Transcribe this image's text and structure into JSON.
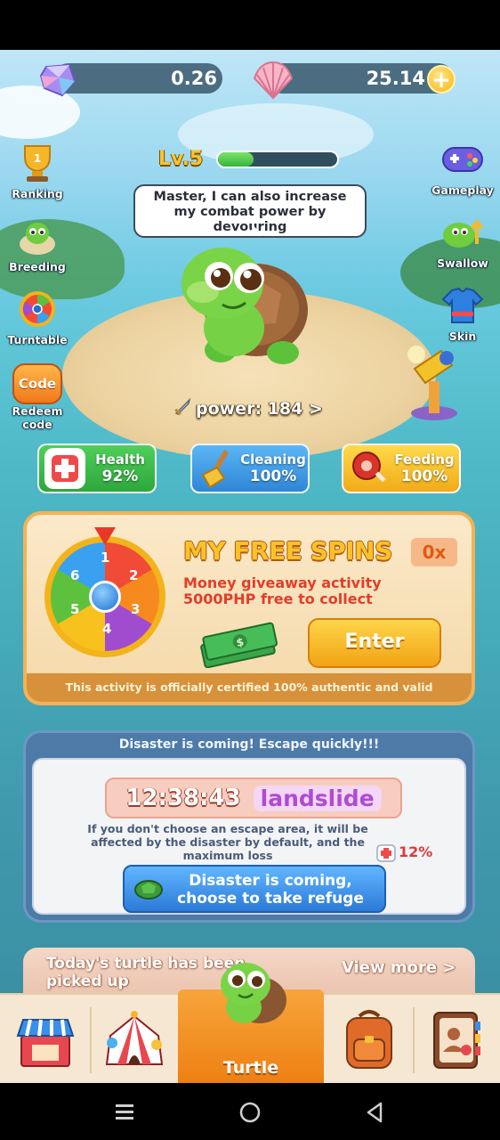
{
  "resources": {
    "gem_amount": "0.26",
    "shell_amount": "25.14",
    "add_symbol": "+"
  },
  "level": {
    "label": "Lv.5",
    "progress": 0.3
  },
  "speech": {
    "text": "Master, I can also increase my combat power by devouring"
  },
  "left_menu": {
    "ranking": "Ranking",
    "breeding": "Breeding",
    "turntable": "Turntable",
    "redeem_badge": "Code",
    "redeem": "Redeem code"
  },
  "right_menu": {
    "gameplay": "Gameplay",
    "swallow": "Swallow",
    "skin": "Skin"
  },
  "power": {
    "text": "power: 184 >"
  },
  "stats": {
    "health": {
      "label": "Health",
      "value": "92%"
    },
    "cleaning": {
      "label": "Cleaning",
      "value": "100%"
    },
    "feeding": {
      "label": "Feeding",
      "value": "100%"
    }
  },
  "free_spins": {
    "title": "MY FREE SPINS",
    "count": "0x",
    "desc_line1": "Money giveaway activity",
    "desc_line2": "5000PHP free to collect",
    "enter_label": "Enter",
    "footer": "This activity is officially certified 100% authentic and valid",
    "wheel_numbers": [
      "1",
      "2",
      "3",
      "4",
      "5",
      "6"
    ]
  },
  "disaster": {
    "header": "Disaster is coming! Escape quickly!!!",
    "timer": "12:38:43",
    "type": "landslide",
    "note": "If you don't choose an escape area, it will be affected by the disaster by default, and the maximum loss",
    "loss_pct": "12%",
    "button_line1": "Disaster is coming,",
    "button_line2": "choose to take refuge"
  },
  "picked": {
    "text": "Today's turtle has been picked up",
    "view_more": "View more >"
  },
  "nav": {
    "turtle": "Turtle"
  },
  "colors": {
    "accent_orange": "#ee7f12",
    "spin_title": "#f9c22a",
    "disaster_blue": "#4e7aa8",
    "landslide_purple": "#b04ad6"
  }
}
